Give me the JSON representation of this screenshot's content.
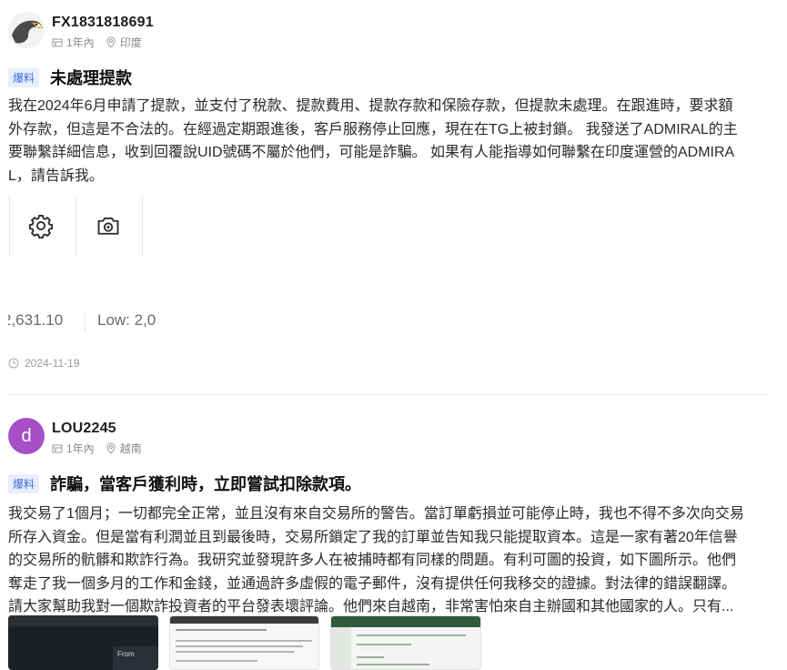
{
  "posts": [
    {
      "username": "FX1831818691",
      "duration": "1年內",
      "location": "印度",
      "tag": "爆料",
      "title": "未處理提款",
      "body_lines": [
        "我在2024年6月申請了提款，並支付了稅款、提款費用、提款存款和保險存款，但提款未處理。在跟進時，要求額",
        "外存款，但這是不合法的。在經過定期跟進後，客戶服務停止回應，現在在TG上被封鎖。 我發送了ADMIRAL的主",
        "要聯繫詳細信息，收到回覆說UID號碼不屬於他們，可能是詐騙。 如果有人能指導如何聯繫在印度運營的ADMIRA",
        "L，請告訴我。"
      ],
      "ticker_close": "2,631.10",
      "ticker_low": "Low: 2,0",
      "date": "2024-11-19"
    },
    {
      "username": "LOU2245",
      "avatar_letter": "d",
      "duration": "1年內",
      "location": "越南",
      "tag": "爆料",
      "title": "詐騙，當客戶獲利時，立即嘗試扣除款項。",
      "body_lines": [
        "我交易了1個月；一切都完全正常，並且沒有來自交易所的警告。當訂單虧損並可能停止時，我也不得不多次向交易",
        "所存入資金。但是當有利潤並且到最後時，交易所鎖定了我的訂單並告知我只能提取資本。這是一家有著20年信譽",
        "的交易所的骯髒和欺詐行為。我研究並發現許多人在被捕時都有同樣的問題。有利可圖的投資，如下圖所示。他們",
        "奪走了我一個多月的工作和金錢，並通過許多虛假的電子郵件，沒有提供任何我移交的證據。對法律的錯誤翻譯。",
        "請大家幫助我對一個欺詐投資者的平台發表壞評論。他們來自越南，非常害怕來自主辦國和其他國家的人。只有..."
      ],
      "screenshot_text": "From"
    }
  ],
  "colors": {
    "tag_bg": "#e9eefb",
    "tag_text": "#3b6de0",
    "avatar2_bg": "#a64fc7",
    "meta_gray": "#8a8a8a"
  },
  "icons": [
    "building-icon",
    "location-pin-icon",
    "gear-icon",
    "camera-icon",
    "clock-icon"
  ]
}
